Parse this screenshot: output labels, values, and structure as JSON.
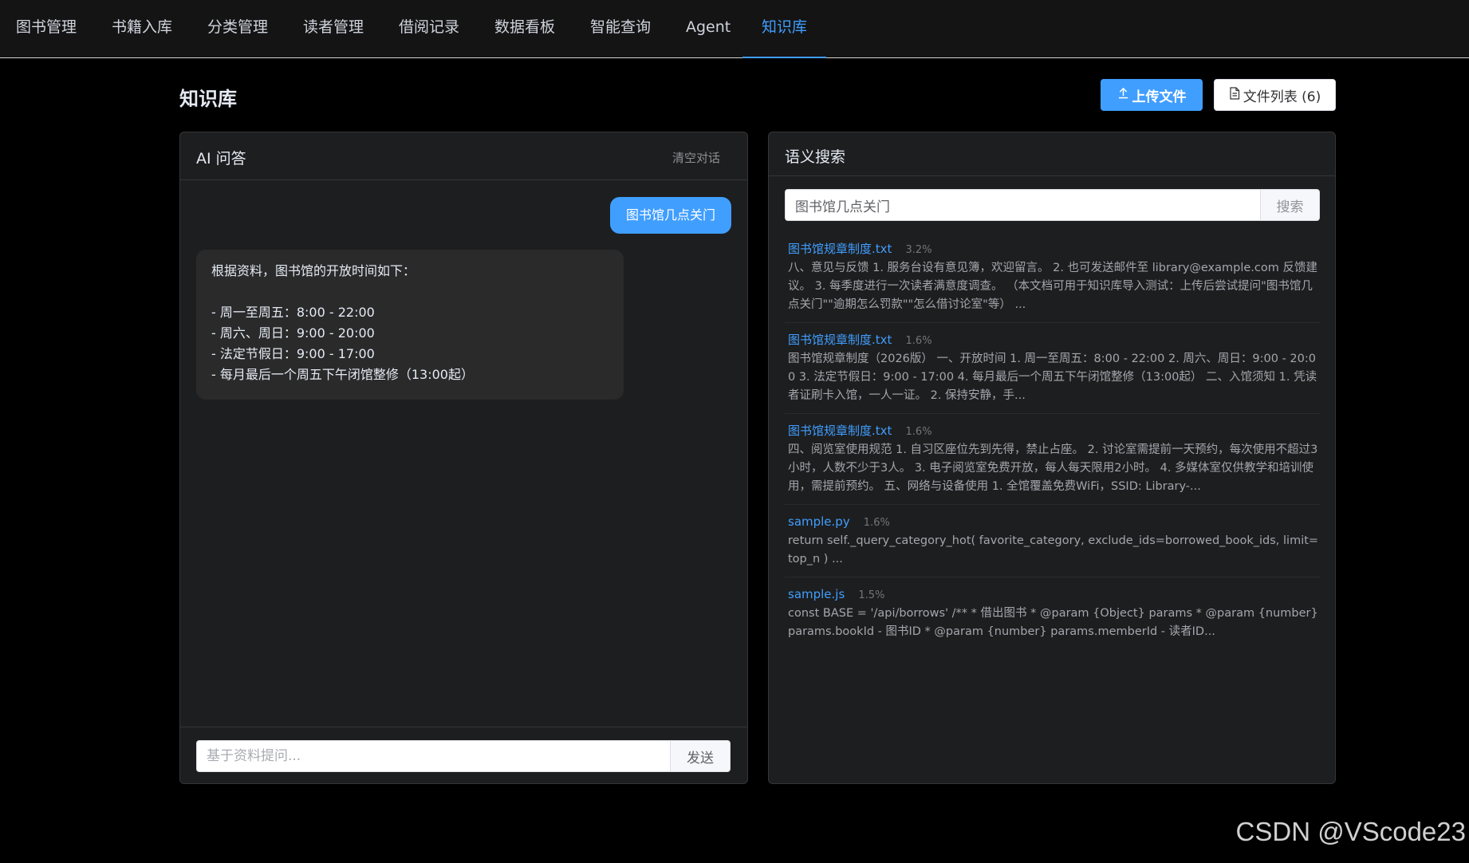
{
  "nav": {
    "items": [
      {
        "label": "图书管理"
      },
      {
        "label": "书籍入库"
      },
      {
        "label": "分类管理"
      },
      {
        "label": "读者管理"
      },
      {
        "label": "借阅记录"
      },
      {
        "label": "数据看板"
      },
      {
        "label": "智能查询"
      },
      {
        "label": "Agent"
      },
      {
        "label": "知识库"
      }
    ],
    "active_index": 8
  },
  "page": {
    "title": "知识库",
    "upload_label": "上传文件",
    "files_label": "文件列表 (6)"
  },
  "chat": {
    "title": "AI 问答",
    "clear_label": "清空对话",
    "user_message": "图书馆几点关门",
    "ai_lines": [
      "根据资料，图书馆的开放时间如下：",
      "",
      "- 周一至周五：8:00 - 22:00",
      "- 周六、周日：9:00 - 20:00",
      "- 法定节假日：9:00 - 17:00",
      "- 每月最后一个周五下午闭馆整修（13:00起）"
    ],
    "input_placeholder": "基于资料提问...",
    "send_label": "发送"
  },
  "search": {
    "title": "语义搜索",
    "query": "图书馆几点关门",
    "button_label": "搜索",
    "results": [
      {
        "file": "图书馆规章制度.txt",
        "score": "3.2%",
        "snippet": "八、意见与反馈 1. 服务台设有意见簿，欢迎留言。 2. 也可发送邮件至 library@example.com 反馈建议。 3. 每季度进行一次读者满意度调查。 （本文档可用于知识库导入测试：上传后尝试提问\"图书馆几点关门\"\"逾期怎么罚款\"\"怎么借讨论室\"等） ..."
      },
      {
        "file": "图书馆规章制度.txt",
        "score": "1.6%",
        "snippet": "图书馆规章制度（2026版） 一、开放时间 1. 周一至周五：8:00 - 22:00 2. 周六、周日：9:00 - 20:00 3. 法定节假日：9:00 - 17:00 4. 每月最后一个周五下午闭馆整修（13:00起） 二、入馆须知 1. 凭读者证刷卡入馆，一人一证。 2. 保持安静，手..."
      },
      {
        "file": "图书馆规章制度.txt",
        "score": "1.6%",
        "snippet": "四、阅览室使用规范 1. 自习区座位先到先得，禁止占座。 2. 讨论室需提前一天预约，每次使用不超过3小时，人数不少于3人。 3. 电子阅览室免费开放，每人每天限用2小时。 4. 多媒体室仅供教学和培训使用，需提前预约。 五、网络与设备使用 1. 全馆覆盖免费WiFi，SSID: Library-..."
      },
      {
        "file": "sample.py",
        "score": "1.6%",
        "snippet": "return self._query_category_hot( favorite_category, exclude_ids=borrowed_book_ids, limit=top_n ) ..."
      },
      {
        "file": "sample.js",
        "score": "1.5%",
        "snippet": "const BASE = '/api/borrows' /** * 借出图书 * @param {Object} params * @param {number} params.bookId - 图书ID * @param {number} params.memberId - 读者ID..."
      }
    ]
  },
  "watermark": "CSDN @VScode23",
  "colors": {
    "accent": "#409eff",
    "background": "#000000",
    "card": "#1d1e1f",
    "bubble_ai": "#2a2a2b"
  }
}
